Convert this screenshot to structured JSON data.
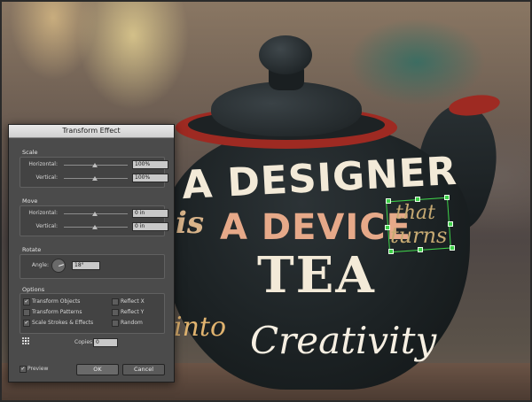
{
  "artwork": {
    "line1": "A DESIGNER",
    "line2a": "is",
    "line2b": "A DEVICE",
    "line3": "TEA",
    "line4a": "into",
    "line4b": "Creativity",
    "selected_line1": "that",
    "selected_line2": "turns"
  },
  "dialog": {
    "title": "Transform Effect",
    "scale": {
      "label": "Scale",
      "horizontal_label": "Horizontal:",
      "horizontal_value": "100%",
      "vertical_label": "Vertical:",
      "vertical_value": "100%"
    },
    "move": {
      "label": "Move",
      "horizontal_label": "Horizontal:",
      "horizontal_value": "0 in",
      "vertical_label": "Vertical:",
      "vertical_value": "0 in"
    },
    "rotate": {
      "label": "Rotate",
      "angle_label": "Angle:",
      "angle_value": "18°"
    },
    "options": {
      "label": "Options",
      "transform_objects": "Transform Objects",
      "transform_patterns": "Transform Patterns",
      "scale_strokes": "Scale Strokes & Effects",
      "reflect_x": "Reflect X",
      "reflect_y": "Reflect Y",
      "random": "Random",
      "check_glyph": "✓"
    },
    "copies_label": "Copies",
    "copies_value": "0",
    "preview_label": "Preview",
    "ok_label": "OK",
    "cancel_label": "Cancel"
  }
}
